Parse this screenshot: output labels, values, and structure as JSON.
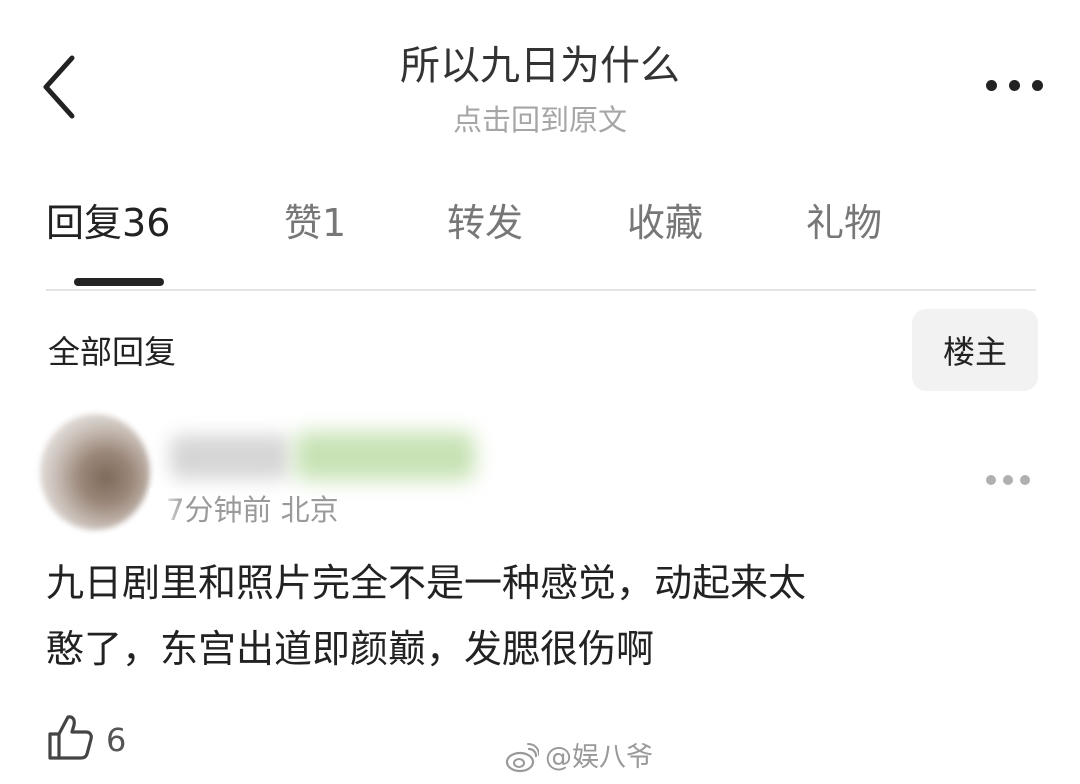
{
  "header": {
    "title": "所以九日为什么",
    "subtitle": "点击回到原文",
    "back_icon": "chevron-left-icon",
    "more_icon": "ellipsis-icon"
  },
  "tabs": [
    {
      "label": "回复",
      "count": "36",
      "active": true
    },
    {
      "label": "赞",
      "count": "1",
      "active": false
    },
    {
      "label": "转发",
      "count": "",
      "active": false
    },
    {
      "label": "收藏",
      "count": "",
      "active": false
    },
    {
      "label": "礼物",
      "count": "",
      "active": false
    }
  ],
  "replies_section": {
    "title": "全部回复",
    "filter_button": "楼主"
  },
  "comment": {
    "meta": "7分钟前 北京",
    "text_line1": "九日剧里和照片完全不是一种感觉，动起来太",
    "text_line2": "憨了，东宫出道即颜巅，发腮很伤啊",
    "likes": "6"
  },
  "watermark": {
    "text": "@娱八爷"
  },
  "colors": {
    "text_primary": "#222222",
    "text_secondary": "#a6a6a6",
    "button_bg": "#f2f2f2",
    "divider": "#e4e4e4"
  }
}
